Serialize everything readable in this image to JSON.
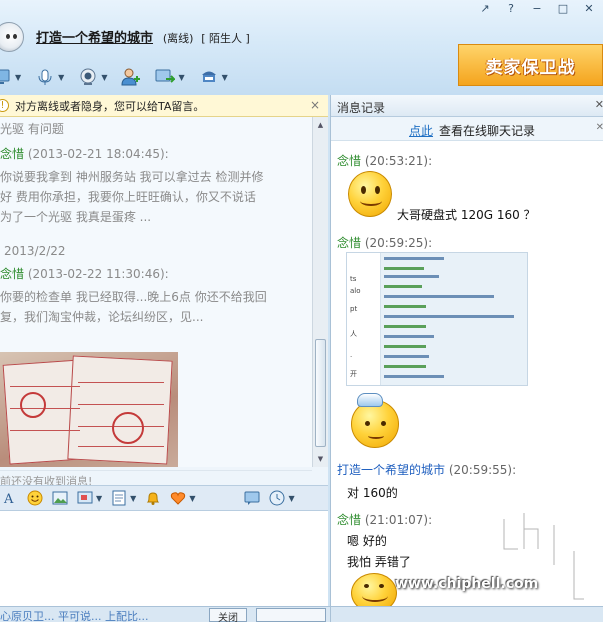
{
  "window": {
    "controls": [
      "↗",
      "?",
      "−",
      "□",
      "✕"
    ],
    "control_names": [
      "restore-down-icon",
      "help-icon",
      "pin-icon",
      "maximize-icon",
      "close-icon"
    ]
  },
  "contact": {
    "name": "打造一个希望的城市",
    "status": "(离线)",
    "group": "[ 陌生人 ]"
  },
  "toolbar": {
    "items": [
      "screen-share-icon",
      "voice-icon",
      "camera-icon",
      "add-friend-icon",
      "transfer-icon",
      "shop-icon"
    ]
  },
  "ad": {
    "text": "卖家保卫战"
  },
  "notice": {
    "text": "对方离线或者隐身，您可以给TA留言。",
    "close": "×"
  },
  "history": {
    "lines": [
      {
        "kind": "text",
        "text": "光驱 有问题"
      },
      {
        "kind": "header",
        "sender": "念惜",
        "time": " (2013-02-21 18:04:45):"
      },
      {
        "kind": "text",
        "text": "你说要我拿到 神州服务站 我可以拿过去   检测并修"
      },
      {
        "kind": "text",
        "text": "好  费用你承担，我要你上旺旺确认，你又不说话"
      },
      {
        "kind": "text",
        "text": "为了一个光驱 我真是蛋疼 ..."
      },
      {
        "kind": "date",
        "text": "2013/2/22"
      },
      {
        "kind": "header",
        "sender": "念惜",
        "time": " (2013-02-22 11:30:46):"
      },
      {
        "kind": "text",
        "text": "你要的检查单 我已经取得...晚上6点 你还不给我回"
      },
      {
        "kind": "text",
        "text": "复，我们淘宝仲裁，论坛纠纷区，见..."
      }
    ],
    "no_message": "前还没有收到消息!"
  },
  "input_toolbar": {
    "items": [
      "font-icon",
      "emoticon-icon",
      "image-icon",
      "screenshot-icon",
      "doc-icon",
      "bell-icon",
      "heart-icon",
      "chat-mode-icon",
      "clock-icon"
    ]
  },
  "bottom": {
    "left_link": "心原贝卫... 平可说... 上配比...",
    "close_label": "关闭",
    "send_label": ""
  },
  "log": {
    "title": "消息记录",
    "online_link": "点此",
    "online_text": "查看在线聊天记录",
    "messages": [
      {
        "sender": "念惜",
        "time": " (20:53:21):",
        "text": "大哥硬盘式 120G 160 ？"
      },
      {
        "sender": "念惜",
        "time": " (20:59:25):",
        "text": ""
      },
      {
        "sender": "打造一个希望的城市",
        "time": " (20:59:55):",
        "text": "对 160的"
      },
      {
        "sender": "念惜",
        "time": " (21:01:07):",
        "text": "嗯 好的"
      }
    ],
    "extra_text": "我怕 弄错了"
  },
  "watermark": {
    "url": "www.chiphell.com",
    "logo": "chiphell"
  },
  "colors": {
    "accent": "#1f6fc3",
    "sender_self": "#2f8d2f",
    "sender_other": "#1f5fbf",
    "ad": "#f4a41d"
  }
}
